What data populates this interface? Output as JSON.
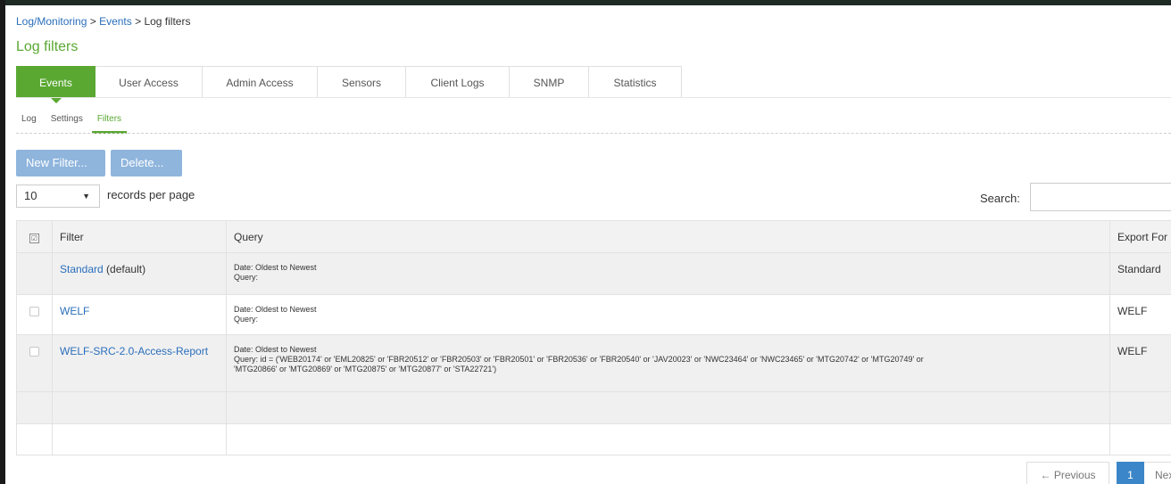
{
  "breadcrumb": {
    "items": [
      "Log/Monitoring",
      "Events"
    ],
    "current": "Log filters",
    "separator": " > "
  },
  "page_title": "Log filters",
  "tabs": [
    {
      "label": "Events",
      "active": true
    },
    {
      "label": "User Access",
      "active": false
    },
    {
      "label": "Admin Access",
      "active": false
    },
    {
      "label": "Sensors",
      "active": false
    },
    {
      "label": "Client Logs",
      "active": false
    },
    {
      "label": "SNMP",
      "active": false
    },
    {
      "label": "Statistics",
      "active": false
    }
  ],
  "subtabs": [
    {
      "label": "Log",
      "active": false
    },
    {
      "label": "Settings",
      "active": false
    },
    {
      "label": "Filters",
      "active": true
    }
  ],
  "buttons": {
    "new_filter": "New Filter...",
    "delete": "Delete..."
  },
  "page_size": {
    "value": "10",
    "label": "records per page"
  },
  "search": {
    "label": "Search:",
    "value": ""
  },
  "table": {
    "headers": {
      "filter": "Filter",
      "query": "Query",
      "export": "Export For"
    },
    "rows": [
      {
        "name": "Standard",
        "suffix": " (default)",
        "has_checkbox": false,
        "query_lines": [
          "Date: Oldest to Newest",
          "Query:"
        ],
        "export": "Standard"
      },
      {
        "name": "WELF",
        "suffix": "",
        "has_checkbox": true,
        "query_lines": [
          "Date: Oldest to Newest",
          "Query:"
        ],
        "export": "WELF"
      },
      {
        "name": "WELF-SRC-2.0-Access-Report",
        "suffix": "",
        "has_checkbox": true,
        "query_lines": [
          "Date: Oldest to Newest",
          "Query: id = ('WEB20174' or 'EML20825' or 'FBR20512' or 'FBR20503' or 'FBR20501' or 'FBR20536' or 'FBR20540' or 'JAV20023' or 'NWC23464' or 'NWC23465' or 'MTG20742' or 'MTG20749' or",
          "'MTG20866' or 'MTG20869' or 'MTG20875' or 'MTG20877' or 'STA22721')"
        ],
        "export": "WELF"
      }
    ]
  },
  "pagination": {
    "previous": "← Previous",
    "current": "1",
    "next": "Next"
  },
  "colors": {
    "accent_green": "#5aa832",
    "link_blue": "#2a6ebb",
    "button_blue": "#8fb5dd",
    "pager_blue": "#3b86c8"
  }
}
